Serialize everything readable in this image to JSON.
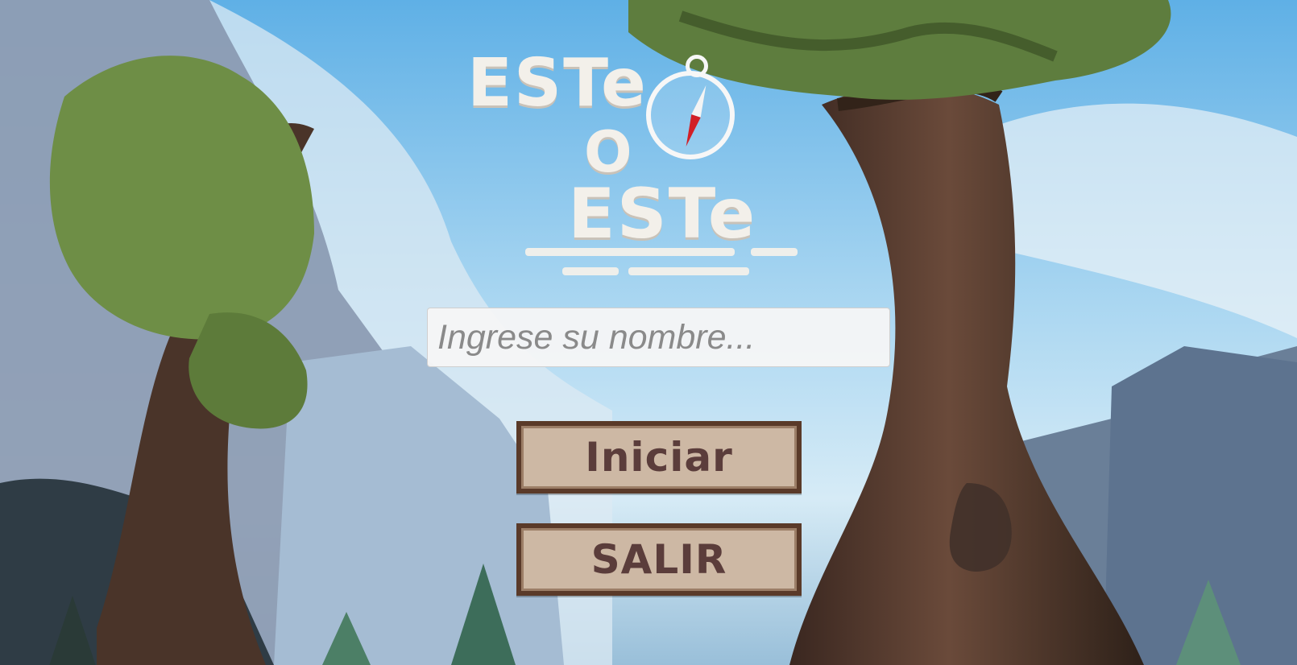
{
  "game": {
    "logo": {
      "line1": "ESTe",
      "line2": "O",
      "line3": "ESTe",
      "compass_icon": "compass-icon"
    },
    "name_input": {
      "placeholder": "Ingrese su nombre...",
      "value": ""
    },
    "buttons": {
      "start": "Iniciar",
      "exit": "SALIR"
    }
  },
  "colors": {
    "sky": "#8cc7ee",
    "tree_dark": "#473126",
    "leaves": "#6f8e45",
    "button_bg": "#cdb8a4",
    "button_border": "#5a3a29",
    "button_text": "#5b3d3b",
    "logo_text": "#f3f0ea"
  }
}
